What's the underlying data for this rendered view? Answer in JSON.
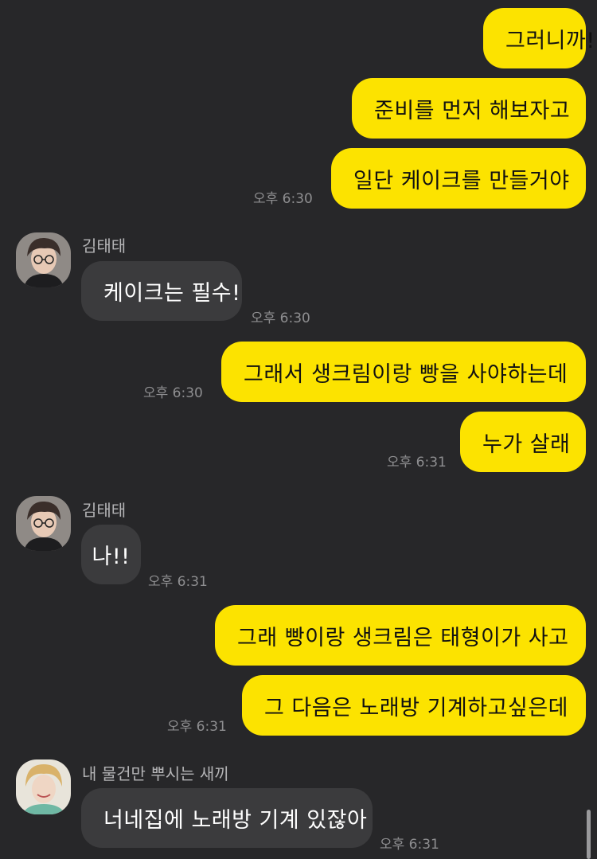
{
  "messages": [
    {
      "text": "그러니까!"
    },
    {
      "text": "준비를 먼저 해보자고"
    },
    {
      "text": "일단 케이크를 만들거야",
      "time": "오후 6:30"
    },
    {
      "name": "김태태",
      "text": "케이크는 필수!",
      "time": "오후 6:30"
    },
    {
      "text": "그래서 생크림이랑 빵을 사야하는데",
      "time": "오후 6:30"
    },
    {
      "text": "누가 살래",
      "time": "오후 6:31"
    },
    {
      "name": "김태태",
      "text": "나!!",
      "time": "오후 6:31"
    },
    {
      "text": "그래 빵이랑 생크림은 태형이가 사고"
    },
    {
      "text": "그 다음은 노래방 기계하고싶은데",
      "time": "오후 6:31"
    },
    {
      "name": "내 물건만 뿌시는 새끼",
      "text": "너네집에 노래방 기계 있잖아",
      "time": "오후 6:31"
    }
  ],
  "colors": {
    "background": "#272729",
    "my_bubble": "#FCE300",
    "their_bubble": "#3B3B3D",
    "timestamp": "#8E8E90"
  }
}
